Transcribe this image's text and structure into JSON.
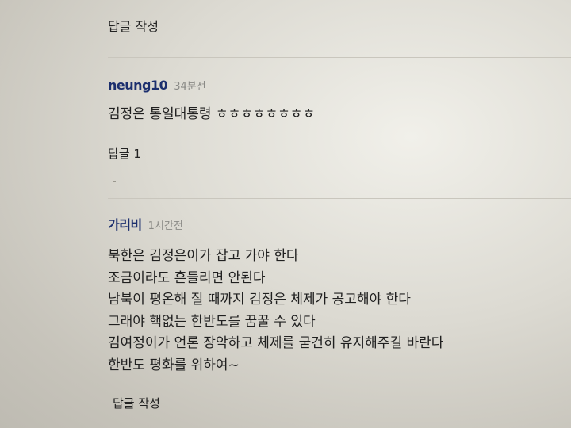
{
  "top": {
    "write_reply_label": "답글 작성"
  },
  "comments": [
    {
      "author": "neung10",
      "time": "34분전",
      "body": "김정은 통일대통령 ㅎㅎㅎㅎㅎㅎㅎㅎ",
      "reply_count_label": "답글 1"
    },
    {
      "author": "가리비",
      "time": "1시간전",
      "lines": [
        "북한은 김정은이가 잡고 가야 한다",
        "조금이라도 흔들리면 안된다",
        "남북이 평온해 질 때까지 김정은 체제가 공고해야 한다",
        "그래야 핵없는 한반도를 꿈꿀 수 있다",
        "김여정이가 언론 장악하고 체제를 굳건히 유지해주길 바란다",
        "한반도 평화를 위하여~"
      ],
      "write_reply_label": "답글 작성"
    }
  ]
}
